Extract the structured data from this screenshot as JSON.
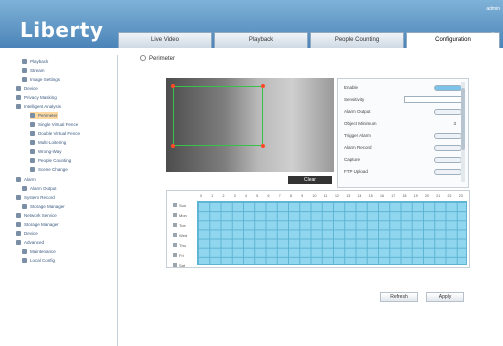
{
  "app": {
    "logo": "Liberty"
  },
  "header": {
    "tabs": [
      {
        "label": "Live Video"
      },
      {
        "label": "Playback"
      },
      {
        "label": "People Counting"
      },
      {
        "label": "Configuration",
        "active": true
      }
    ],
    "corner_text": "⚙",
    "corner_top_text": "admin"
  },
  "sidebar": {
    "items": [
      {
        "label": "Playback",
        "icon": "folder-icon"
      },
      {
        "label": "Stream",
        "icon": "stream-icon"
      },
      {
        "label": "Image Settings",
        "icon": "image-icon"
      },
      {
        "label": "Device",
        "icon": "device-icon"
      },
      {
        "label": "Privacy Masking",
        "icon": "mask-icon"
      },
      {
        "label": "Intelligent Analysis",
        "icon": "analysis-icon"
      },
      {
        "label": "Perimeter",
        "icon": "perimeter-icon",
        "selected": true
      },
      {
        "label": "Single Virtual Fence",
        "icon": "fence-icon"
      },
      {
        "label": "Double Virtual Fence",
        "icon": "fence2-icon"
      },
      {
        "label": "Multi-Loitering",
        "icon": "loiter-icon"
      },
      {
        "label": "Wrong-Way",
        "icon": "wrongway-icon"
      },
      {
        "label": "People Counting",
        "icon": "people-icon"
      },
      {
        "label": "Scene Change",
        "icon": "scene-icon"
      },
      {
        "label": "Alarm",
        "icon": "alarm-icon"
      },
      {
        "label": "Alarm Output",
        "icon": "alarm-output-icon"
      },
      {
        "label": "System Record",
        "icon": "record-icon"
      },
      {
        "label": "Storage Manager",
        "icon": "storage-icon"
      },
      {
        "label": "Network Service",
        "icon": "network-icon"
      },
      {
        "label": "Storage Manager",
        "icon": "storage2-icon"
      },
      {
        "label": "Device",
        "icon": "device2-icon"
      },
      {
        "label": "Advanced",
        "icon": "advanced-icon"
      },
      {
        "label": "Maintenance",
        "icon": "maintenance-icon"
      },
      {
        "label": "Local Config",
        "icon": "local-config-icon"
      }
    ]
  },
  "breadcrumb": {
    "label": "Perimeter"
  },
  "video": {
    "clear_label": "Clear"
  },
  "settings": {
    "rows": [
      {
        "label": "Enable",
        "control": "toggle-on"
      },
      {
        "label": "Sensitivity",
        "control": "select",
        "value": ""
      },
      {
        "label": "Alarm Output",
        "control": "toggle"
      },
      {
        "label": "Object Minimum",
        "control": "number",
        "value": "3"
      },
      {
        "label": "Trigger Alarm",
        "control": "toggle"
      },
      {
        "label": "Alarm Record",
        "control": "toggle"
      },
      {
        "label": "Capture",
        "control": "toggle"
      },
      {
        "label": "FTP Upload",
        "control": "toggle"
      }
    ]
  },
  "schedule": {
    "days": [
      "Sun",
      "Mon",
      "Tue",
      "Wed",
      "Thu",
      "Fri",
      "Sat"
    ],
    "hours": [
      "0",
      "1",
      "2",
      "3",
      "4",
      "5",
      "6",
      "7",
      "8",
      "9",
      "10",
      "11",
      "12",
      "13",
      "14",
      "15",
      "16",
      "17",
      "18",
      "19",
      "20",
      "21",
      "22",
      "23"
    ]
  },
  "actions": {
    "refresh_label": "Refresh",
    "apply_label": "Apply"
  }
}
